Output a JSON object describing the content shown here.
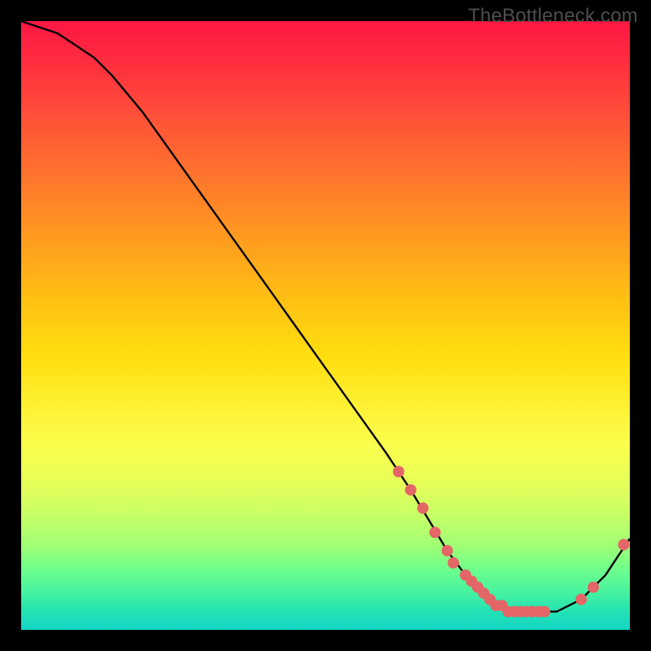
{
  "watermark": "TheBottleneck.com",
  "colors": {
    "curve": "#000000",
    "dot": "#e46666",
    "dot_stroke": "#c24040"
  },
  "chart_data": {
    "type": "line",
    "title": "",
    "xlabel": "",
    "ylabel": "",
    "xlim": [
      0,
      100
    ],
    "ylim": [
      0,
      100
    ],
    "note": "No axis ticks or numeric labels are visible; values below are estimated in percent-of-plot coordinates (0–100 on each axis, y = 0 at bottom). The curve descends from top-left, reaches a flat minimum near x ≈ 70–86, then rises toward the right edge.",
    "series": [
      {
        "name": "curve",
        "x": [
          0,
          3,
          6,
          9,
          12,
          15,
          20,
          25,
          30,
          35,
          40,
          45,
          50,
          55,
          60,
          64,
          67,
          70,
          73,
          76,
          79,
          82,
          85,
          88,
          90,
          92,
          94,
          96,
          98,
          100
        ],
        "y": [
          100,
          99,
          98,
          96,
          94,
          91,
          85,
          78,
          71,
          64,
          57,
          50,
          43,
          36,
          29,
          23,
          18,
          13,
          9,
          6,
          4,
          3,
          3,
          3,
          4,
          5,
          7,
          9,
          12,
          15
        ]
      }
    ],
    "dots": {
      "name": "highlighted-points",
      "note": "Pink/coral dots overlaid on the curve, clustered on the descending slope, across the minimum trough, and on the rising tail.",
      "x": [
        62,
        64,
        66,
        68,
        70,
        71,
        73,
        74,
        75,
        76,
        77,
        78,
        79,
        80,
        81,
        82,
        83,
        84,
        85,
        86,
        92,
        94,
        99
      ],
      "y": [
        26,
        23,
        20,
        16,
        13,
        11,
        9,
        8,
        7,
        6,
        5,
        4,
        4,
        3,
        3,
        3,
        3,
        3,
        3,
        3,
        5,
        7,
        14
      ]
    }
  }
}
